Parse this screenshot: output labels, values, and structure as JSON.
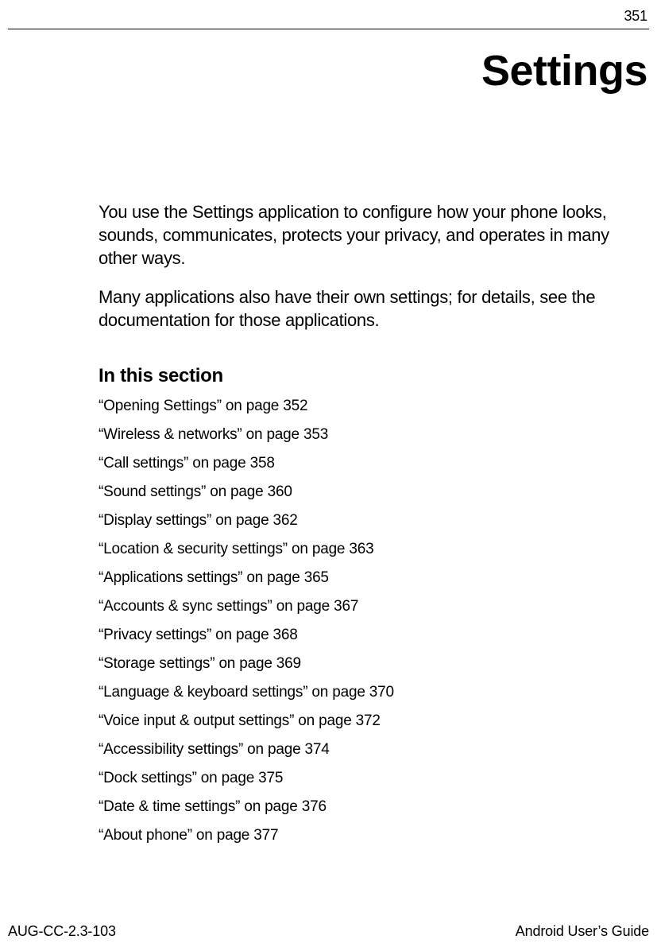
{
  "page_number": "351",
  "title": "Settings",
  "intro": [
    "You use the Settings application to configure how your phone looks, sounds, communicates, protects your privacy, and operates in many other ways.",
    "Many applications also have their own settings; for details, see the documentation for those applications."
  ],
  "section_heading": "In this section",
  "toc": [
    "“Opening Settings” on page 352",
    "“Wireless & networks” on page 353",
    "“Call settings” on page 358",
    "“Sound settings” on page 360",
    "“Display settings” on page 362",
    "“Location & security settings” on page 363",
    "“Applications settings” on page 365",
    "“Accounts & sync settings” on page 367",
    "“Privacy settings” on page 368",
    "“Storage settings” on page 369",
    "“Language & keyboard settings” on page 370",
    "“Voice input & output settings” on page 372",
    "“Accessibility settings” on page 374",
    "“Dock settings” on page 375",
    "“Date & time settings” on page 376",
    "“About phone” on page 377"
  ],
  "footer": {
    "left": "AUG-CC-2.3-103",
    "right": "Android User’s Guide"
  }
}
